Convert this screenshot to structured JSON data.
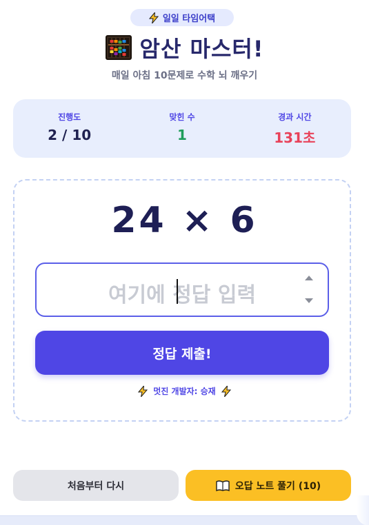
{
  "badge": {
    "label": "일일 타임어택"
  },
  "title": "암산 마스터!",
  "subtitle": "매일 아침 10문제로 수학 뇌 깨우기",
  "stats": [
    {
      "label": "진행도",
      "value": "2 / 10"
    },
    {
      "label": "맞힌 수",
      "value": "1"
    },
    {
      "label": "경과 시간",
      "value": "131초"
    }
  ],
  "problem": {
    "text": "24 × 6"
  },
  "answer": {
    "placeholder": "여기에 정답 입력",
    "value": ""
  },
  "submit": {
    "label": "정답 제출!"
  },
  "credit": {
    "text": "멋진 개발자: 승재"
  },
  "footer": {
    "restart_label": "처음부터 다시",
    "review_label": "오답 노트 풀기 (10)"
  },
  "colors": {
    "accent": "#4f46e5",
    "correct": "#1f9d5b",
    "time": "#e8425a",
    "review": "#fbbf24",
    "stats_bg": "#e8eefd"
  },
  "icons": [
    "lightning-icon",
    "abacus-icon",
    "book-icon"
  ]
}
